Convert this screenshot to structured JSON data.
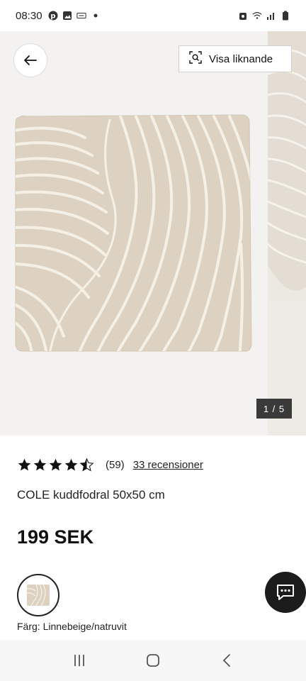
{
  "status_bar": {
    "time": "08:30",
    "left_icons": [
      "pinterest-icon",
      "gallery-icon",
      "data-saver-icon",
      "dot-icon"
    ],
    "right_icons": [
      "alarm-icon",
      "wifi-icon",
      "signal-icon",
      "battery-icon"
    ]
  },
  "gallery": {
    "similar_label": "Visa liknande",
    "counter": "1 / 5"
  },
  "product": {
    "rating": 4.5,
    "rating_count": "(59)",
    "reviews_label": "33 recensioner",
    "title": "COLE kuddfodral 50x50 cm",
    "price": "199 SEK",
    "color_label": "Färg: Linnebeige/natruvit"
  },
  "colors": {
    "cushion": "#ddd2c2",
    "cushion_pattern": "#f5f0e6",
    "gallery_bg": "#f3f2f0",
    "chat_button": "#1c1c1c"
  }
}
